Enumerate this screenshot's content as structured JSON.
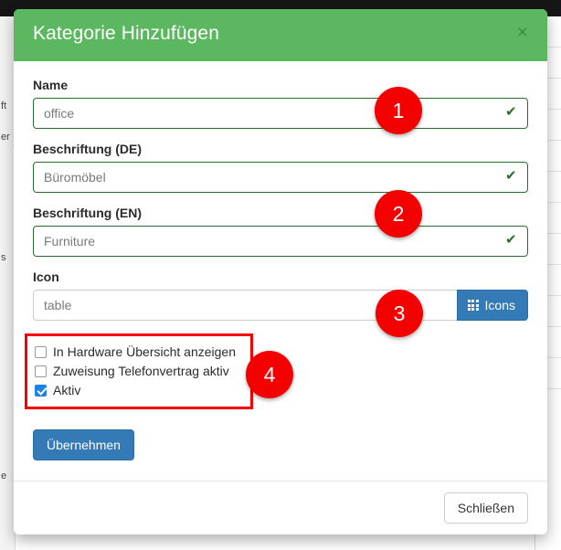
{
  "background": {
    "left_labels": [
      "ft",
      "er",
      "s",
      "e"
    ],
    "right_rows": [
      ":",
      ":",
      ":",
      ":",
      ":",
      ":",
      ":",
      ":",
      ":",
      ":",
      ":",
      ":"
    ],
    "bottom_row_text": "e"
  },
  "modal": {
    "title": "Kategorie Hinzufügen",
    "close_icon": "×",
    "fields": [
      {
        "label": "Name",
        "value": "office",
        "placeholder": "Name",
        "valid": true,
        "check_icon": "✔"
      },
      {
        "label": "Beschriftung (DE)",
        "value": "Büromöbel",
        "placeholder": "Beschriftung (DE)",
        "valid": true,
        "check_icon": "✔"
      },
      {
        "label": "Beschriftung (EN)",
        "value": "Furniture",
        "placeholder": "Beschriftung (EN)",
        "valid": true,
        "check_icon": "✔"
      }
    ],
    "icon_field": {
      "label": "Icon",
      "value": "table",
      "placeholder": "Icon",
      "button_label": "Icons"
    },
    "checkboxes": [
      {
        "label": "In Hardware Übersicht anzeigen",
        "checked": false
      },
      {
        "label": "Zuweisung Telefonvertrag aktiv",
        "checked": false
      },
      {
        "label": "Aktiv",
        "checked": true
      }
    ],
    "submit_label": "Übernehmen",
    "close_label": "Schließen"
  },
  "annotations": {
    "badges": [
      "1",
      "2",
      "3",
      "4"
    ]
  },
  "colors": {
    "header_green": "#5cb860",
    "primary_blue": "#337ab7",
    "annotation_red": "#f40000",
    "valid_green": "#2e6b32",
    "checkbox_blue": "#1e80e8"
  }
}
